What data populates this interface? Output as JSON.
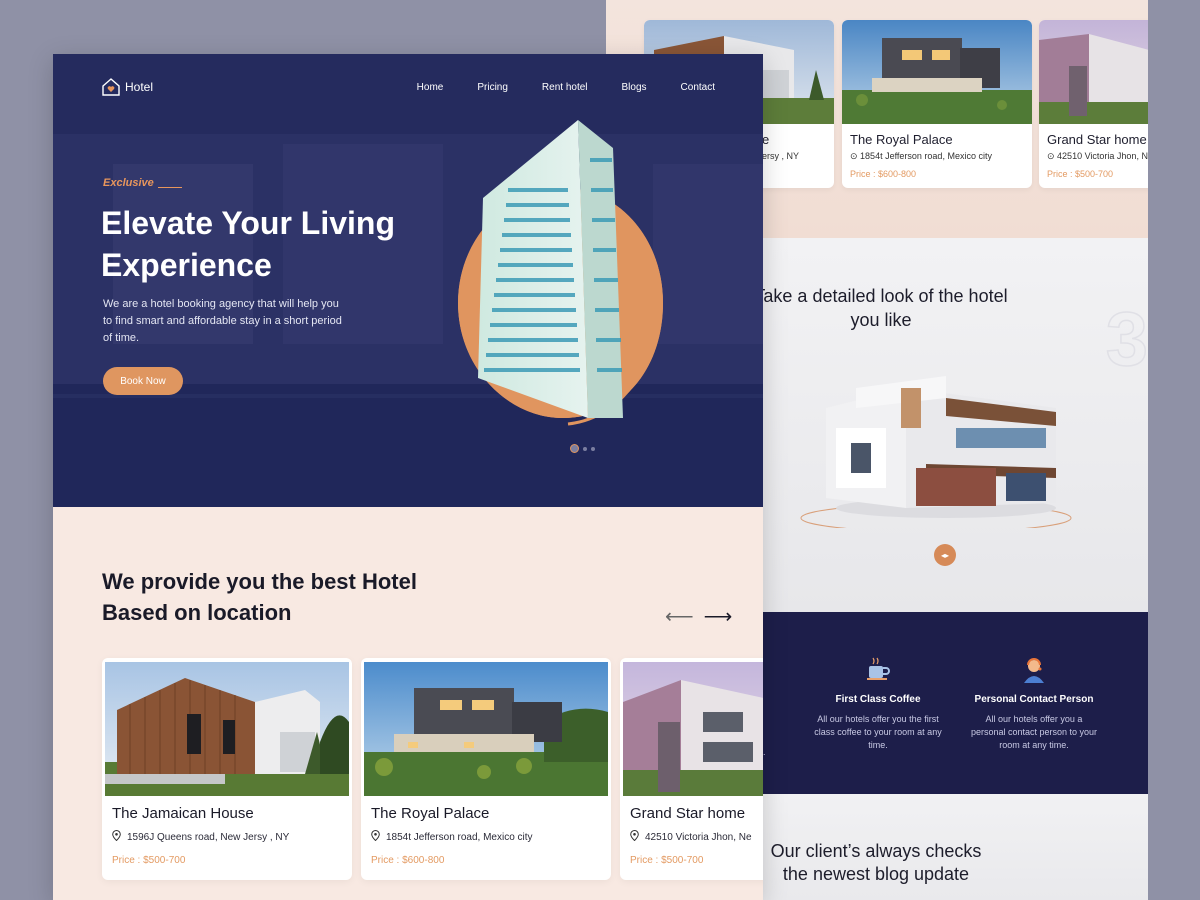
{
  "nav": {
    "logo_text": "Hotel",
    "links": [
      "Home",
      "Pricing",
      "Rent hotel",
      "Blogs",
      "Contact"
    ]
  },
  "hero": {
    "tag": "Exclusive",
    "title": "Elevate Your Living Experience",
    "description": "We are a hotel booking agency that will help you to find smart and affordable stay in a short period of time.",
    "cta": "Book Now",
    "slides": 3,
    "active_slide": 0
  },
  "locations": {
    "title": "We provide you the best Hotel Based on location",
    "prev_icon": "arrow-left-icon",
    "next_icon": "arrow-right-icon",
    "cards": [
      {
        "name": "The Jamaican House",
        "address": "1596J Queens road, New Jersy , NY",
        "price": "Price : $500-700"
      },
      {
        "name": "The Royal Palace",
        "address": "1854t Jefferson road, Mexico city",
        "price": "Price : $600-800"
      },
      {
        "name": "Grand Star home",
        "address": "42510 Victoria Jhon, Ne",
        "price": "Price : $500-700"
      }
    ]
  },
  "back": {
    "cards": [
      {
        "name": "e",
        "address": "ersy , NY",
        "price": ""
      },
      {
        "name": "The Royal Palace",
        "address": "1854t Jefferson road, Mexico city",
        "price": "Price : $600-800"
      },
      {
        "name": "Grand Star home",
        "address": "42510 Victoria Jhon, Ne",
        "price": "Price : $500-700"
      }
    ],
    "look_title": "Take a detailed look of the hotel you like",
    "big_number": "3",
    "services": [
      {
        "title": "First Class Coffee",
        "description": "All our hotels offer you the first class coffee to your room at any time.",
        "icon": "coffee-cup-icon"
      },
      {
        "title": "Personal Contact Person",
        "description": "All our hotels offer you a personal contact person to your room at any time.",
        "icon": "support-agent-icon"
      }
    ],
    "service_cut": [
      "e",
      "e."
    ],
    "blog_title": "Our client’s always checks the newest blog update"
  },
  "colors": {
    "navy": "#252b5e",
    "accent": "#df9660",
    "cream": "#f8e9e2"
  }
}
